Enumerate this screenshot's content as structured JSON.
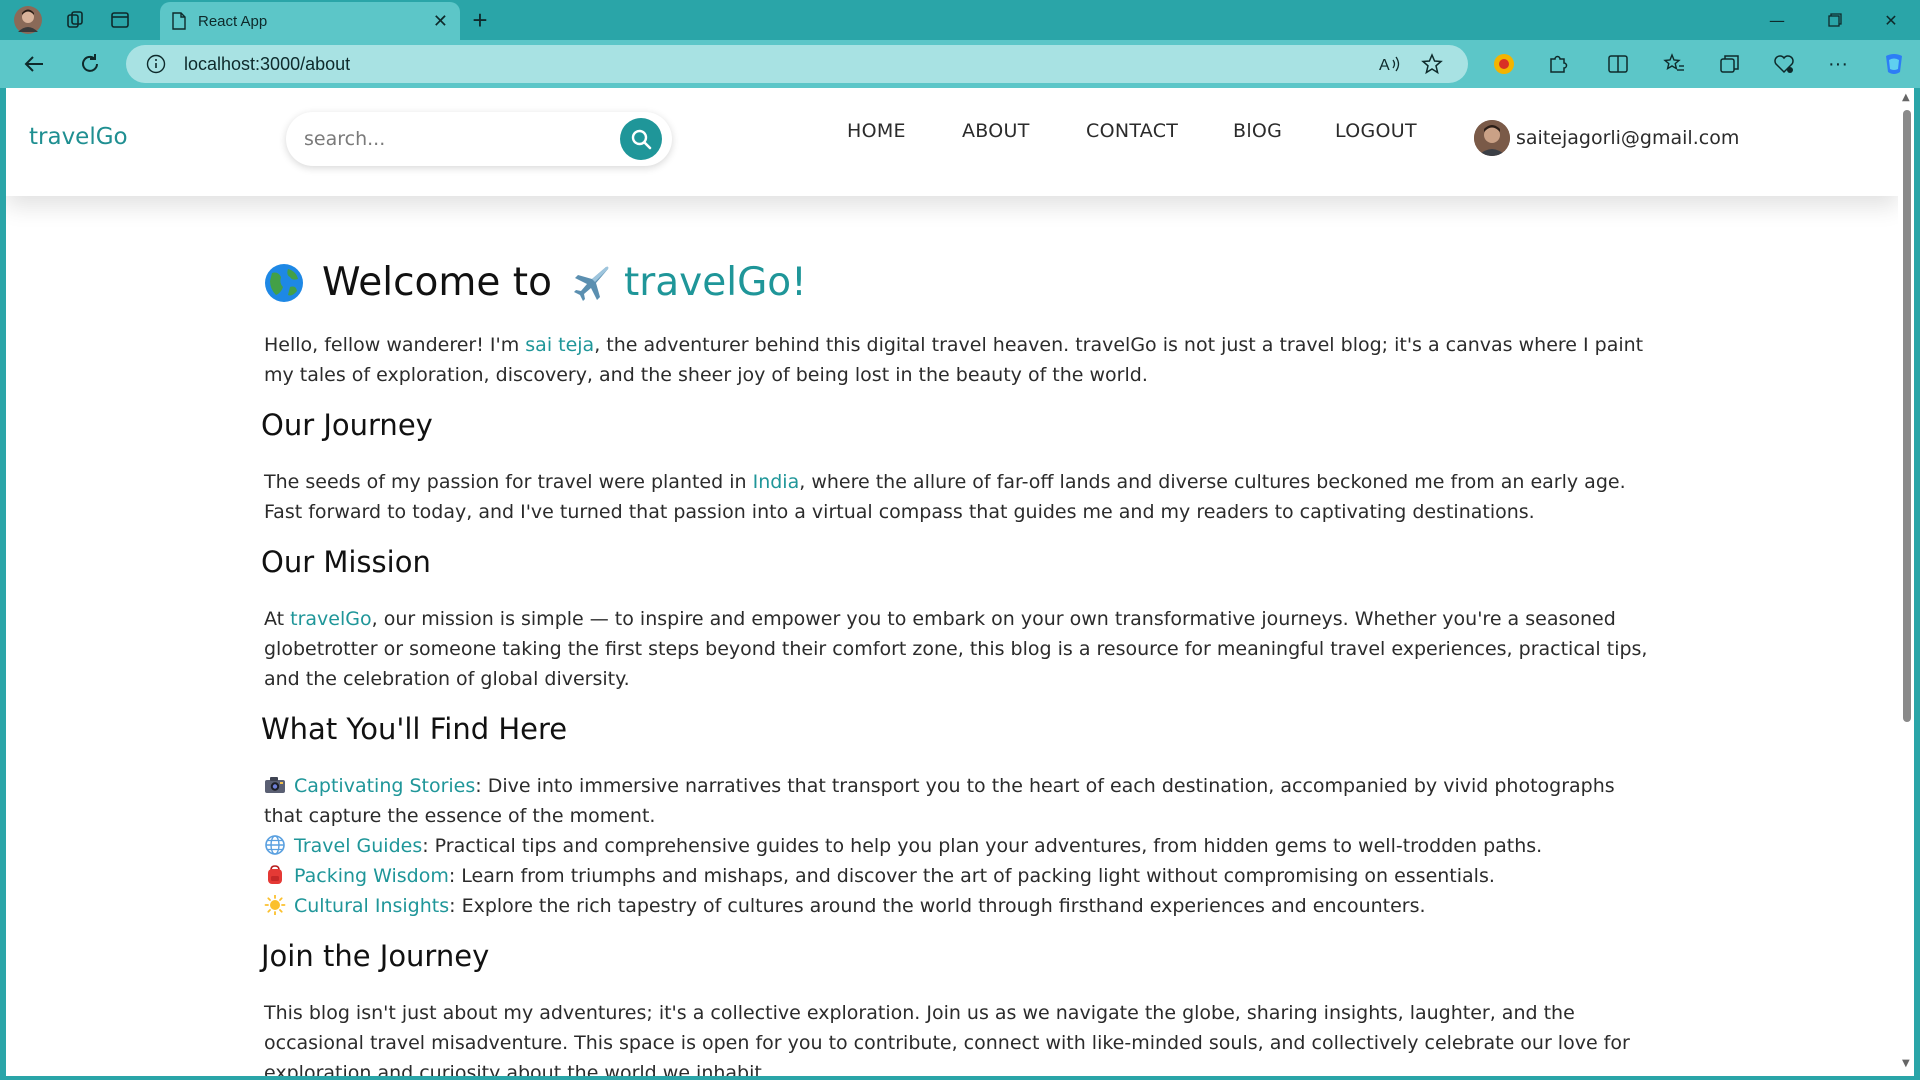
{
  "browser": {
    "tab_title": "React App",
    "url": "localhost:3000/about"
  },
  "site": {
    "logo": "travelGo",
    "search_placeholder": "search...",
    "nav": {
      "home": "HOME",
      "about": "ABOUT",
      "contact": "CONTACT",
      "blog": "BlOG",
      "logout": "LOGOUT"
    },
    "user_email": "saitejagorli@gmail.com"
  },
  "about": {
    "title_pre": "Welcome to",
    "title_brand": "travelGo!",
    "intro": {
      "t1": "Hello, fellow wanderer! I'm ",
      "link": "sai teja",
      "t2": ", the adventurer behind this digital travel heaven. travelGo is not just a travel blog; it's a canvas where I paint my tales of exploration, discovery, and the sheer joy of being lost in the beauty of the world."
    },
    "journey_heading": "Our Journey",
    "journey": {
      "t1": "The seeds of my passion for travel were planted in ",
      "link": "India",
      "t2": ", where the allure of far-off lands and diverse cultures beckoned me from an early age. Fast forward to today, and I've turned that passion into a virtual compass that guides me and my readers to captivating destinations."
    },
    "mission_heading": "Our Mission",
    "mission": {
      "t1": "At ",
      "link": "travelGo",
      "t2": ", our mission is simple — to inspire and empower you to embark on your own transformative journeys. Whether you're a seasoned globetrotter or someone taking the first steps beyond their comfort zone, this blog is a resource for meaningful travel experiences, practical tips, and the celebration of global diversity."
    },
    "find_heading": "What You'll Find Here",
    "items": [
      {
        "icon": "camera-icon",
        "title": "Captivating Stories",
        "text": ": Dive into immersive narratives that transport you to the heart of each destination, accompanied by vivid photographs that capture the essence of the moment."
      },
      {
        "icon": "globe-meridians-icon",
        "title": "Travel Guides",
        "text": ": Practical tips and comprehensive guides to help you plan your adventures, from hidden gems to well-trodden paths."
      },
      {
        "icon": "backpack-icon",
        "title": "Packing Wisdom",
        "text": ": Learn from triumphs and mishaps, and discover the art of packing light without compromising on essentials."
      },
      {
        "icon": "sun-icon",
        "title": "Cultural Insights",
        "text": ": Explore the rich tapestry of cultures around the world through firsthand experiences and encounters."
      }
    ],
    "join_heading": "Join the Journey",
    "join": "This blog isn't just about my adventures; it's a collective exploration. Join us as we navigate the globe, sharing insights, laughter, and the occasional travel misadventure. This space is open for you to contribute, connect with like-minded souls, and collectively celebrate our love for exploration and curiosity about the world we inhabit."
  },
  "colors": {
    "accent": "#1f9699",
    "browser_frame": "#2aa5a8",
    "browser_toolbar": "#5cc6c8"
  }
}
